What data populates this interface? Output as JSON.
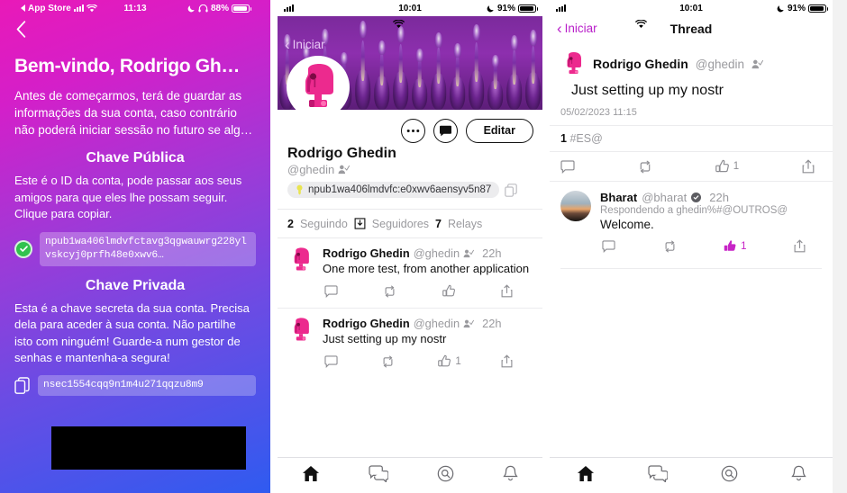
{
  "panel1": {
    "statusbar": {
      "carrier": "App Store",
      "time": "11:13",
      "battery": "88%",
      "icons": [
        "back-triangle-icon",
        "signal-bars-icon",
        "wifi-icon",
        "moon-icon",
        "headphones-icon",
        "battery-icon"
      ]
    },
    "back_icon": "chevron-left-icon",
    "title": "Bem-vindo, Rodrigo Gh…",
    "intro": "Antes de começarmos, terá de guardar as informações da sua conta, caso contrário não poderá iniciar sessão no futuro se alg…",
    "public_heading": "Chave Pública",
    "public_body": "Este é o ID da conta, pode passar aos seus amigos para que eles lhe possam seguir. Clique para copiar.",
    "public_key": "npub1wa406lmdvfctavg3qgwauwrg228ylvskcyj0prfh48e0xwv6…",
    "private_heading": "Chave Privada",
    "private_body": "Esta é a chave secreta da sua conta. Precisa dela para aceder à sua conta. Não partilhe isto com ninguém! Guarde-a num gestor de senhas e mantenha-a segura!",
    "private_key_partial": "nsec1554cqq9n1m4u271qqzu8m9",
    "copy_icon": "copy-icon",
    "check_icon": "check-circle-icon",
    "accent": "#31c24d"
  },
  "panel2": {
    "statusbar": {
      "time": "10:01",
      "battery": "91%"
    },
    "nav_back": "Iniciar",
    "profile": {
      "name": "Rodrigo Ghedin",
      "handle": "@ghedin",
      "npub": "npub1wa406lmdvfc:e0xwv6aensyv5n87",
      "npub_badge_icon": "key-icon",
      "copy_icon": "copy-icon",
      "edit_button": "Editar",
      "more_icon": "ellipsis-icon",
      "message_icon": "chat-filled-icon",
      "verified_icon": "person-check-icon"
    },
    "stats": {
      "following_count": "2",
      "following_label": "Seguindo",
      "followers_icon": "inbox-down-icon",
      "followers_label": "Seguidores",
      "relays_count": "7",
      "relays_label": "Relays"
    },
    "posts": [
      {
        "name": "Rodrigo Ghedin",
        "handle": "@ghedin",
        "time": "22h",
        "text": "One more test, from another application",
        "reply_count": "",
        "repost_count": "",
        "like_count": "",
        "share_count": ""
      },
      {
        "name": "Rodrigo Ghedin",
        "handle": "@ghedin",
        "time": "22h",
        "text": "Just setting up my nostr",
        "reply_count": "",
        "repost_count": "",
        "like_count": "1",
        "share_count": ""
      }
    ],
    "tabs": [
      {
        "icon": "home-icon",
        "active": true
      },
      {
        "icon": "chats-icon",
        "active": false
      },
      {
        "icon": "search-icon",
        "active": false
      },
      {
        "icon": "bell-icon",
        "active": false
      }
    ]
  },
  "panel3": {
    "statusbar": {
      "time": "10:01",
      "battery": "91%"
    },
    "nav_back": "Iniciar",
    "nav_title": "Thread",
    "root_post": {
      "name": "Rodrigo Ghedin",
      "handle": "@ghedin",
      "verified_icon": "person-check-icon",
      "text": "Just setting up my nostr",
      "date": "05/02/2023 11:15",
      "counts_number": "1",
      "counts_label": "#ES@",
      "like_count": "1"
    },
    "reply": {
      "name": "Bharat",
      "handle": "@bharat",
      "verified_icon": "verified-badge-icon",
      "time": "22h",
      "replying_to": "Respondendo a ghedin%#@OUTROS@",
      "text": "Welcome.",
      "like_count": "1",
      "like_color": "#c724c6"
    },
    "tabs": [
      {
        "icon": "home-icon",
        "active": true
      },
      {
        "icon": "chats-icon",
        "active": false
      },
      {
        "icon": "search-icon",
        "active": false
      },
      {
        "icon": "bell-icon",
        "active": false
      }
    ]
  }
}
